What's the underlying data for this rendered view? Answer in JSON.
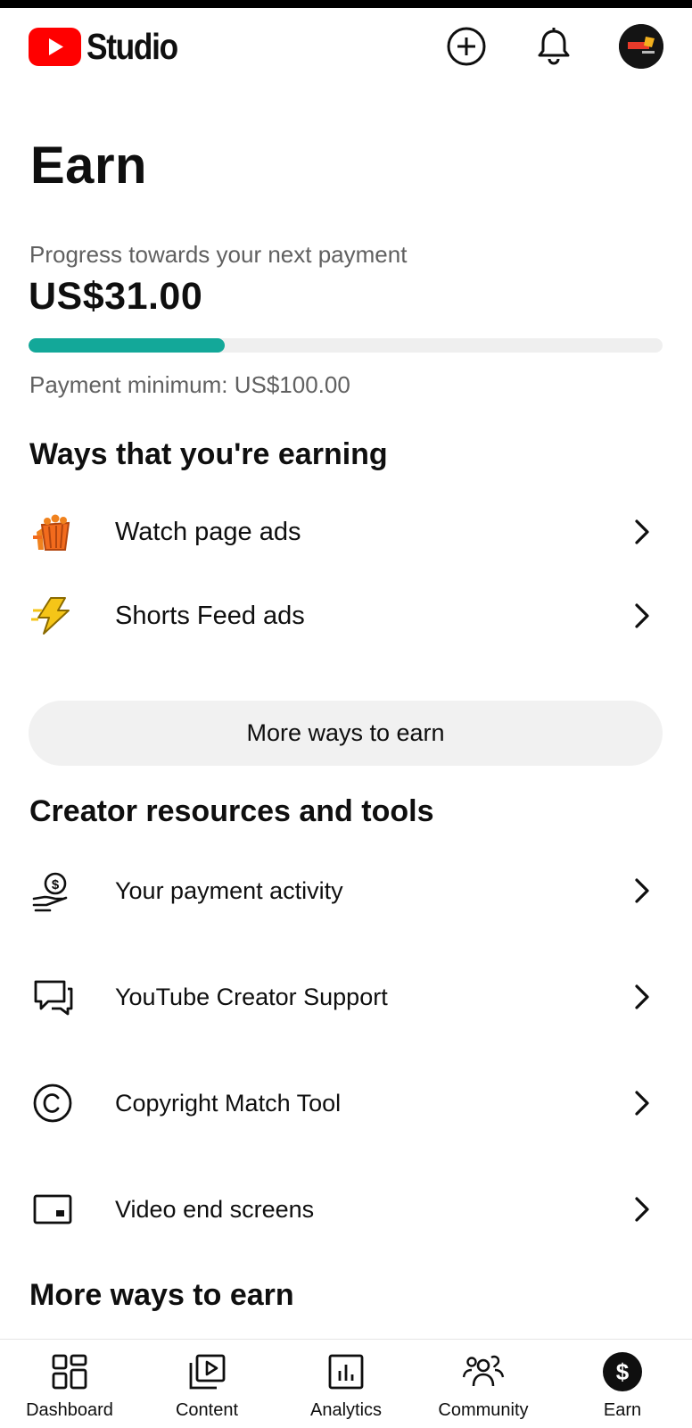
{
  "app": {
    "name": "Studio"
  },
  "header": {
    "icons": [
      "youtube-logo-icon",
      "create-plus-icon",
      "notification-bell-icon",
      "channel-avatar"
    ]
  },
  "page": {
    "title": "Earn"
  },
  "progress": {
    "label": "Progress towards your next payment",
    "amount": "US$31.00",
    "minimum_text": "Payment minimum: US$100.00",
    "fraction": 0.31,
    "color": "#13a899"
  },
  "earning": {
    "heading": "Ways that you're earning",
    "items": [
      {
        "label": "Watch page ads",
        "icon": "watch-page-ads-icon"
      },
      {
        "label": "Shorts Feed ads",
        "icon": "shorts-feed-ads-icon"
      }
    ],
    "more_button": "More ways to earn"
  },
  "resources": {
    "heading": "Creator resources and tools",
    "items": [
      {
        "label": "Your payment activity",
        "icon": "payment-activity-icon"
      },
      {
        "label": "YouTube Creator Support",
        "icon": "creator-support-icon"
      },
      {
        "label": "Copyright Match Tool",
        "icon": "copyright-icon"
      },
      {
        "label": "Video end screens",
        "icon": "end-screen-icon"
      }
    ]
  },
  "more_section": {
    "heading": "More ways to earn"
  },
  "nav": {
    "items": [
      {
        "label": "Dashboard",
        "icon": "dashboard-icon"
      },
      {
        "label": "Content",
        "icon": "content-icon"
      },
      {
        "label": "Analytics",
        "icon": "analytics-icon"
      },
      {
        "label": "Community",
        "icon": "community-icon"
      },
      {
        "label": "Earn",
        "icon": "earn-icon"
      }
    ],
    "active": "Earn"
  },
  "colors": {
    "brand_red": "#ff0000",
    "accent_teal": "#13a899",
    "text": "#0f0f0f",
    "secondary_text": "#606060"
  }
}
